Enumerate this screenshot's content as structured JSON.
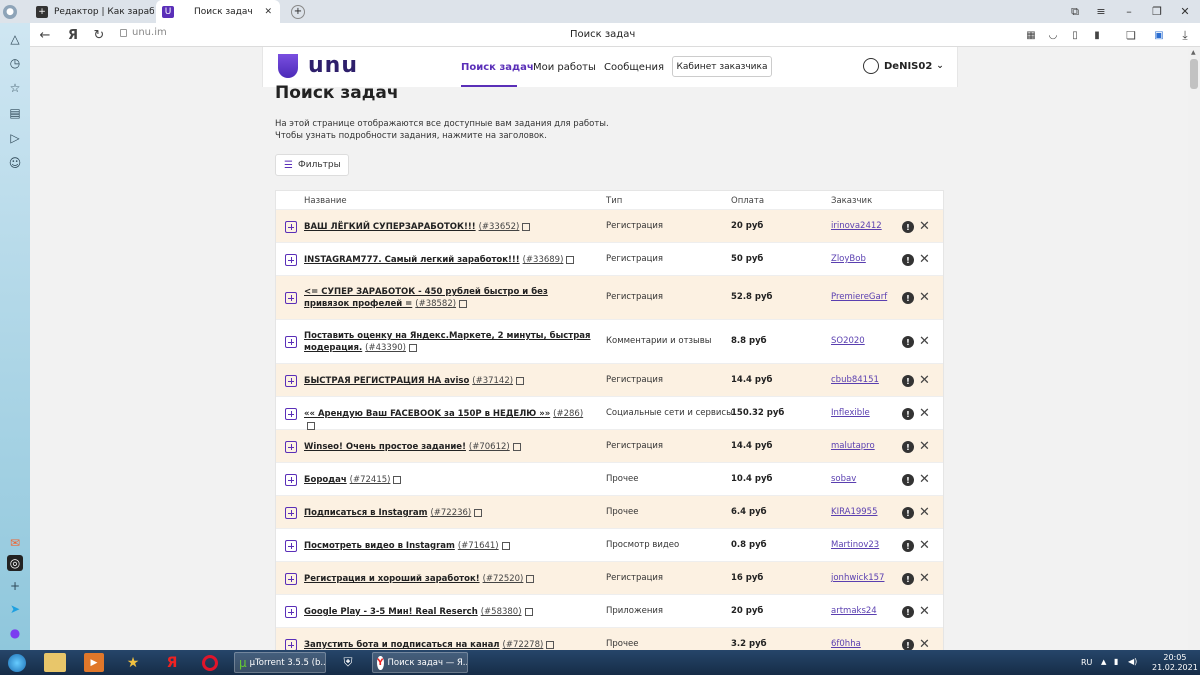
{
  "browser": {
    "tabs": [
      {
        "label": "Редактор | Как заработать",
        "active": false
      },
      {
        "label": "Поиск задач",
        "active": true
      }
    ],
    "url": "unu.im",
    "page_title": "Поиск задач",
    "nav": {
      "back": "←",
      "yandex": "Я",
      "reload": "↻"
    }
  },
  "site": {
    "logo_text": "unu",
    "menu": [
      {
        "label": "Поиск задач",
        "active": true
      },
      {
        "label": "Мои работы",
        "active": false
      },
      {
        "label": "Сообщения",
        "active": false
      }
    ],
    "cabinet_button": "Кабинет заказчика",
    "username": "DeNIS02"
  },
  "main": {
    "title": "Поиск задач",
    "desc1": "На этой странице отображаются все доступные вам задания для работы.",
    "desc2": "Чтобы узнать подробности задания, нажмите на заголовок.",
    "filter_button": "Фильтры"
  },
  "table": {
    "headers": {
      "name": "Название",
      "type": "Тип",
      "pay": "Оплата",
      "customer": "Заказчик"
    },
    "rows": [
      {
        "title": "ВАШ ЛЁГКИЙ СУПЕРЗАРАБОТОК!!!",
        "id": "(#33652)",
        "type": "Регистрация",
        "pay": "20 руб",
        "customer": "irinova2412",
        "highlight": true,
        "tall": false
      },
      {
        "title": "INSTAGRAM777. Самый легкий заработок!!!",
        "id": "(#33689)",
        "type": "Регистрация",
        "pay": "50 руб",
        "customer": "ZloyBob",
        "highlight": false,
        "tall": false
      },
      {
        "title": "<= СУПЕР ЗАРАБОТОК - 450 рублей быстро и без привязок профелей =",
        "id": "(#38582)",
        "type": "Регистрация",
        "pay": "52.8 руб",
        "customer": "PremiereGarf",
        "highlight": true,
        "tall": true
      },
      {
        "title": "Поставить оценку на Яндекс.Маркете, 2 минуты, быстрая модерация.",
        "id": "(#43390)",
        "type": "Комментарии и отзывы",
        "pay": "8.8 руб",
        "customer": "SO2020",
        "highlight": false,
        "tall": true
      },
      {
        "title": "БЫСТРАЯ РЕГИСТРАЦИЯ НА aviso",
        "id": "(#37142)",
        "type": "Регистрация",
        "pay": "14.4 руб",
        "customer": "cbub84151",
        "highlight": true,
        "tall": false
      },
      {
        "title": "«« Арендую Ваш FACEBOOK за 150Р в НЕДЕЛЮ »»",
        "id": "(#286)",
        "type": "Социальные сети и сервисы",
        "pay": "150.32 руб",
        "customer": "Inflexible",
        "highlight": false,
        "tall": false
      },
      {
        "title": "Winseo! Очень простое задание!",
        "id": "(#70612)",
        "type": "Регистрация",
        "pay": "14.4 руб",
        "customer": "malutapro",
        "highlight": true,
        "tall": false
      },
      {
        "title": "Бородач",
        "id": "(#72415)",
        "type": "Прочее",
        "pay": "10.4 руб",
        "customer": "sobav",
        "highlight": false,
        "tall": false
      },
      {
        "title": "Подписаться в Instagram",
        "id": "(#72236)",
        "type": "Прочее",
        "pay": "6.4 руб",
        "customer": "KIRA19955",
        "highlight": true,
        "tall": false
      },
      {
        "title": "Посмотреть видео в Instagram",
        "id": "(#71641)",
        "type": "Просмотр видео",
        "pay": "0.8 руб",
        "customer": "Martinov23",
        "highlight": false,
        "tall": false
      },
      {
        "title": "Регистрация и хороший заработок!",
        "id": "(#72520)",
        "type": "Регистрация",
        "pay": "16 руб",
        "customer": "jonhwick157",
        "highlight": true,
        "tall": false
      },
      {
        "title": "Google Play - 3-5 Мин! Real Reserch",
        "id": "(#58380)",
        "type": "Приложения",
        "pay": "20 руб",
        "customer": "artmaks24",
        "highlight": false,
        "tall": false
      },
      {
        "title": "Запустить бота и подписаться на канал",
        "id": "(#72278)",
        "type": "Прочее",
        "pay": "3.2 руб",
        "customer": "6f0hha",
        "highlight": true,
        "tall": false
      }
    ]
  },
  "taskbar": {
    "items": [
      {
        "label": "µTorrent 3.5.5  (b..."
      },
      {
        "label": "Поиск задач — Я..."
      }
    ],
    "lang": "RU",
    "time": "20:05",
    "date": "21.02.2021"
  },
  "colors": {
    "accent": "#5a2fb8",
    "row_highlight": "#fcf1e2"
  }
}
